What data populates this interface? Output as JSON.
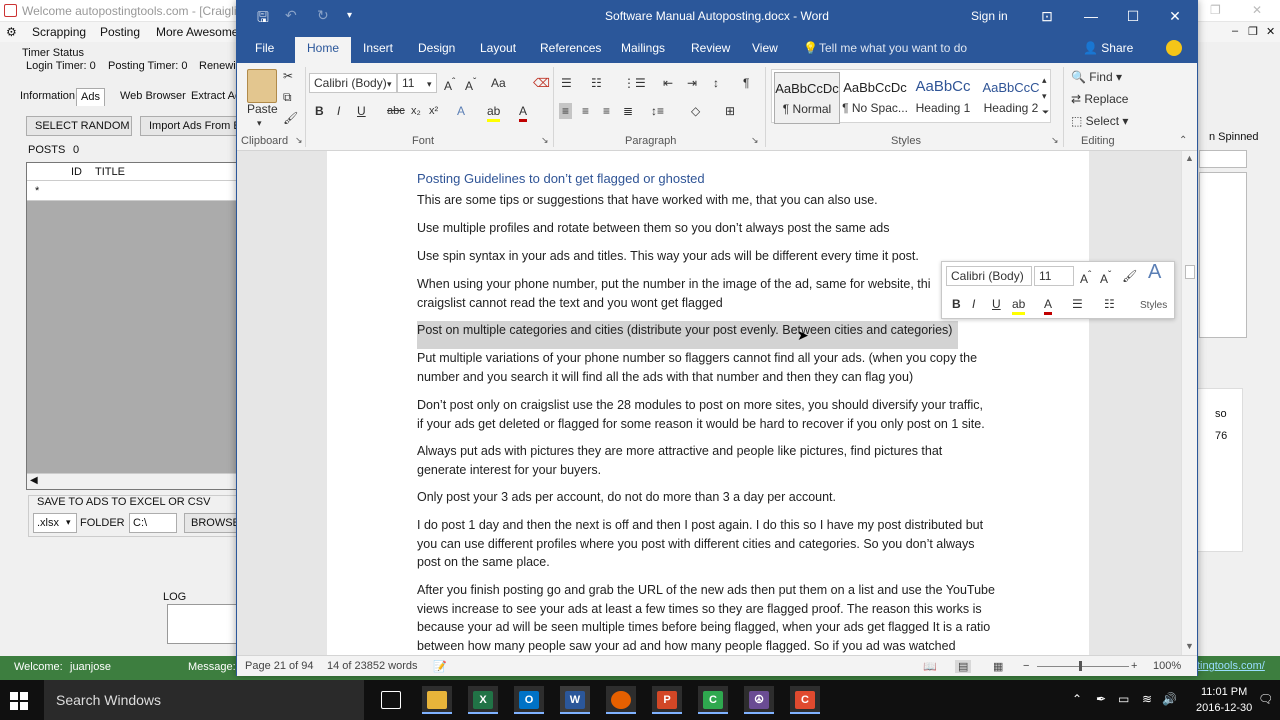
{
  "bg_app": {
    "title": "Welcome autopostingtools.com - [Craiglist",
    "menu": [
      "Scrapping",
      "Posting",
      "More Awesome"
    ],
    "timer_status_label": "Timer Status",
    "login_timer": "Login Timer:  0",
    "posting_timer": "Posting Timer:  0",
    "renewing": "Renewin",
    "tabs": [
      "Information",
      "Ads",
      "Web Browser",
      "Extract Ac"
    ],
    "select_random": "SELECT RANDOM",
    "import_ads": "Import Ads From Ex",
    "posts_label": "POSTS",
    "posts_count": "0",
    "col_id": "ID",
    "col_title": "TITLE",
    "new_row_marker": "*",
    "save_label": "SAVE TO ADS TO EXCEL OR CSV",
    "format_value": ".xlsx",
    "folder_label": "FOLDER",
    "folder_value": "C:\\",
    "browse": "BROWSE",
    "log_label": "LOG",
    "right_spinned": "n Spinned",
    "right_so": "so",
    "right_76": "76",
    "welcome_label": "Welcome:",
    "welcome_user": "juanjose",
    "message_label": "Message:",
    "link_tail": "tingtools.com/"
  },
  "word": {
    "doc_title": "Software Manual Autoposting.docx  -  Word",
    "sign_in": "Sign in",
    "tabs": [
      "File",
      "Home",
      "Insert",
      "Design",
      "Layout",
      "References",
      "Mailings",
      "Review",
      "View"
    ],
    "tell_me": "Tell me what you want to do",
    "share": "Share",
    "clipboard": {
      "paste": "Paste",
      "label": "Clipboard"
    },
    "font": {
      "name": "Calibri (Body)",
      "size": "11",
      "label": "Font"
    },
    "paragraph_label": "Paragraph",
    "styles": {
      "label": "Styles",
      "items": [
        {
          "preview": "AaBbCcDc",
          "name": "¶ Normal"
        },
        {
          "preview": "AaBbCcDc",
          "name": "¶ No Spac..."
        },
        {
          "preview": "AaBbCc",
          "name": "Heading 1"
        },
        {
          "preview": "AaBbCcC",
          "name": "Heading 2"
        }
      ]
    },
    "editing": {
      "find": "Find",
      "replace": "Replace",
      "select": "Select",
      "label": "Editing"
    },
    "heading": "Posting Guidelines to don’t get flagged or ghosted",
    "paragraphs": [
      [
        "This are some tips or suggestions that have worked with me, that you can also use."
      ],
      [
        "Use multiple profiles and rotate between them so you don’t always post the same ads"
      ],
      [
        "Use spin syntax in your ads and titles. This way your ads will be different every time it post."
      ],
      [
        "When using your phone number, put the number in the image of the ad, same for website, thi",
        "craigslist cannot read the text and you wont get flagged"
      ],
      [
        "Post on multiple categories and cities (distribute your post evenly. Between cities and categories)"
      ],
      [
        "Put multiple variations of your phone number so flaggers cannot find all your ads. (when you copy the",
        "number and you search it will find all the ads with that number and then they can flag you)"
      ],
      [
        "Don’t post only on craigslist use the 28 modules to post on more sites, you should diversify your traffic,",
        "if your ads get deleted or flagged for some reason it would be hard to recover if you only post on 1 site."
      ],
      [
        "Always put ads with pictures they are more attractive and people like pictures, find pictures that",
        "generate interest for your buyers."
      ],
      [
        "Only post your 3 ads per account, do not do more than 3 a day per account."
      ],
      [
        "I do post 1 day and then the next is off and then I post again. I do this so I have my post distributed but",
        "you can use different profiles where you post with different cities and categories. So you don’t always",
        "post on the same place."
      ],
      [
        "After you finish posting go and grab the URL of the new ads then put them on a list and use the YouTube",
        "views increase to see your ads at least a few times so they are flagged proof. The reason this works is",
        "because your ad will be seen multiple times before being flagged, when your ads get flagged It is a ratio",
        "between how many people saw your ad and how many people flagged. So if you ad was watched"
      ]
    ],
    "mini": {
      "font": "Calibri (Body)",
      "size": "11",
      "styles": "Styles"
    },
    "status": {
      "page": "Page 21 of 94",
      "words": "14 of 23852 words",
      "zoom": "100%"
    }
  },
  "taskbar": {
    "search": "Search Windows",
    "time": "11:01 PM",
    "date": "2016-12-30",
    "apps": [
      {
        "name": "task-view",
        "color": "#101010",
        "glyph": "▭"
      },
      {
        "name": "file-explorer",
        "color": "#e8b43a",
        "glyph": ""
      },
      {
        "name": "excel",
        "color": "#217346",
        "glyph": "X"
      },
      {
        "name": "outlook",
        "color": "#0072c6",
        "glyph": "O"
      },
      {
        "name": "word",
        "color": "#2b579a",
        "glyph": "W"
      },
      {
        "name": "firefox",
        "color": "#e66000",
        "glyph": ""
      },
      {
        "name": "powerpoint",
        "color": "#d24726",
        "glyph": "P"
      },
      {
        "name": "camtasia",
        "color": "#2fa84f",
        "glyph": "C"
      },
      {
        "name": "peace-app",
        "color": "#6a4c93",
        "glyph": "☮"
      },
      {
        "name": "recorder",
        "color": "#e04a2f",
        "glyph": "C"
      }
    ]
  }
}
